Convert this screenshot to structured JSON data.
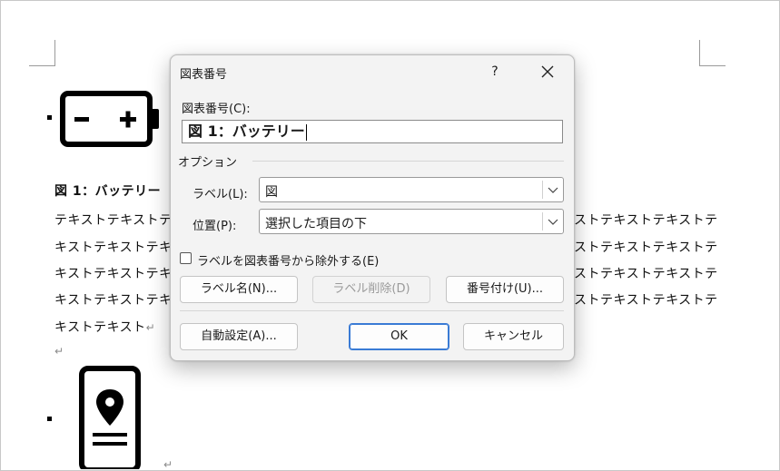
{
  "document": {
    "caption": "図 1：バッテリー",
    "body_lines_left": [
      "テキストテキストテ",
      "キストテキストテキ",
      "キストテキストテキ",
      "キストテキストテキ",
      "キストテキスト"
    ],
    "body_lines_right": [
      "ストテキストテキストテ",
      "ストテキストテキストテ",
      "ストテキストテキストテ",
      "ストテキストテキストテ"
    ],
    "paragraph_mark": "↵"
  },
  "dialog": {
    "title": "図表番号",
    "help_label": "?",
    "caption_label": "図表番号(C):",
    "caption_value": "図 1：バッテリー",
    "options_label": "オプション",
    "label_label": "ラベル(L):",
    "label_value": "図",
    "position_label": "位置(P):",
    "position_value": "選択した項目の下",
    "exclude_checkbox_label": "ラベルを図表番号から除外する(E)",
    "exclude_checked": false,
    "buttons": {
      "new_label": "ラベル名(N)...",
      "delete_label": "ラベル削除(D)",
      "numbering": "番号付け(U)...",
      "autocaption": "自動設定(A)...",
      "ok": "OK",
      "cancel": "キャンセル"
    }
  }
}
